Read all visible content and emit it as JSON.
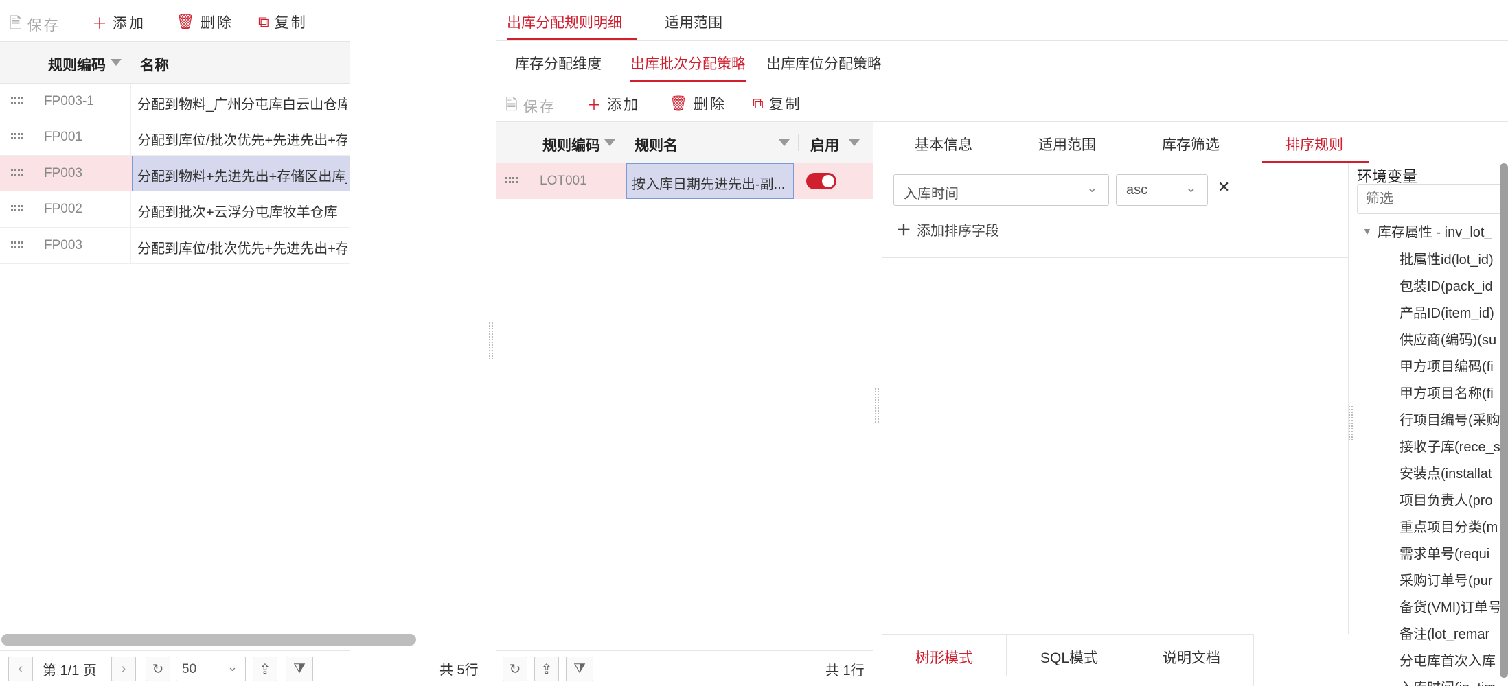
{
  "left": {
    "toolbar": {
      "save": "保存",
      "add": "添加",
      "delete": "删除",
      "copy": "复制"
    },
    "columns": {
      "code": "规则编码",
      "name": "名称"
    },
    "rows": [
      {
        "code": "FP003-1",
        "name": "分配到物料_广州分屯库白云山仓库"
      },
      {
        "code": "FP001",
        "name": "分配到库位/批次优先+先进先出+存储区出库_通用规则"
      },
      {
        "code": "FP003",
        "name": "分配到物料+先进先出+存储区出库_上海通贸仓"
      },
      {
        "code": "FP002",
        "name": "分配到批次+云浮分屯库牧羊仓库"
      },
      {
        "code": "FP003",
        "name": "分配到库位/批次优先+先进先出+存储区/合格状态出库"
      }
    ],
    "footer": {
      "page": "第 1/1 页",
      "page_size": "50",
      "total": "共 5行"
    }
  },
  "main_tabs": [
    "出库分配规则明细",
    "适用范围"
  ],
  "sub_tabs": [
    "库存分配维度",
    "出库批次分配策略",
    "出库库位分配策略"
  ],
  "mid": {
    "toolbar": {
      "save": "保存",
      "add": "添加",
      "delete": "删除",
      "copy": "复制"
    },
    "columns": {
      "code": "规则编码",
      "name": "规则名",
      "enabled": "启用"
    },
    "rows": [
      {
        "code": "LOT001",
        "name": "按入库日期先进先出-副...",
        "enabled": true
      }
    ],
    "footer": {
      "total": "共 1行"
    }
  },
  "detail_tabs": [
    "基本信息",
    "适用范围",
    "库存筛选",
    "排序规则"
  ],
  "sort": {
    "field": "入库时间",
    "order": "asc",
    "add_label": "添加排序字段"
  },
  "bottom_tabs": [
    "树形模式",
    "SQL模式",
    "说明文档"
  ],
  "env": {
    "title": "环境变量",
    "filter_placeholder": "筛选",
    "group": "库存属性 - inv_lot_",
    "items": [
      "批属性id(lot_id)",
      "包装ID(pack_id",
      "产品ID(item_id)",
      "供应商(编码)(su",
      "甲方项目编码(fi",
      "甲方项目名称(fi",
      "行项目编号(采购",
      "接收子库(rece_s",
      "安装点(installat",
      "项目负责人(pro",
      "重点项目分类(m",
      "需求单号(requi",
      "采购订单号(pur",
      "备货(VMI)订单号",
      "备注(lot_remar",
      "分屯库首次入库",
      "入库时间(in_tim"
    ]
  },
  "colors": {
    "accent": "#d0202f",
    "selected_row": "#fbe3e5",
    "selected_cell": "#d6d9ee"
  }
}
